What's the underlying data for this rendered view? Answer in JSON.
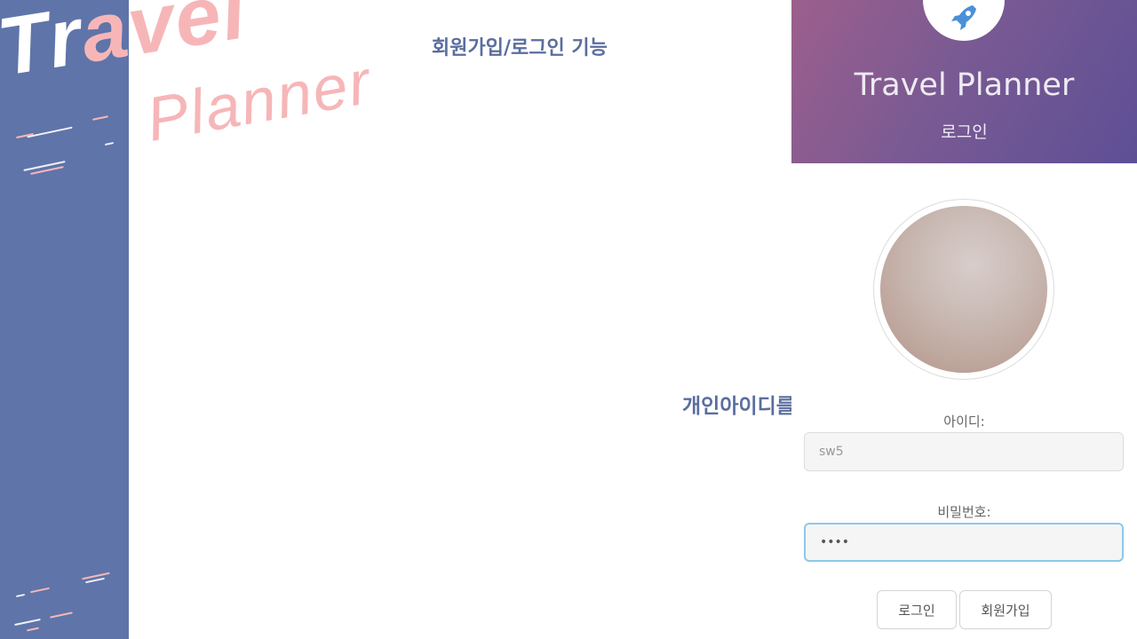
{
  "slide": {
    "title": "회원가입/로그인 기능",
    "caption": "개인아이디를 생성",
    "logo_travel_a": "Tr",
    "logo_travel_b": "avel",
    "logo_planner": "Planner"
  },
  "colors": {
    "sidebar": "#5f74a9",
    "accent_pink": "#f6b6b8",
    "title_blue": "#5a6e9e",
    "header_gradient_start": "#9c5f8c",
    "header_gradient_end": "#5d4f95",
    "input_focus": "#8fc8e8"
  },
  "app": {
    "icon": "rocket-icon",
    "title": "Travel Planner",
    "subtitle": "로그인",
    "id_label": "아이디:",
    "id_value": "sw5",
    "password_label": "비밀번호:",
    "password_value": "••••",
    "login_button": "로그인",
    "signup_button": "회원가입"
  }
}
